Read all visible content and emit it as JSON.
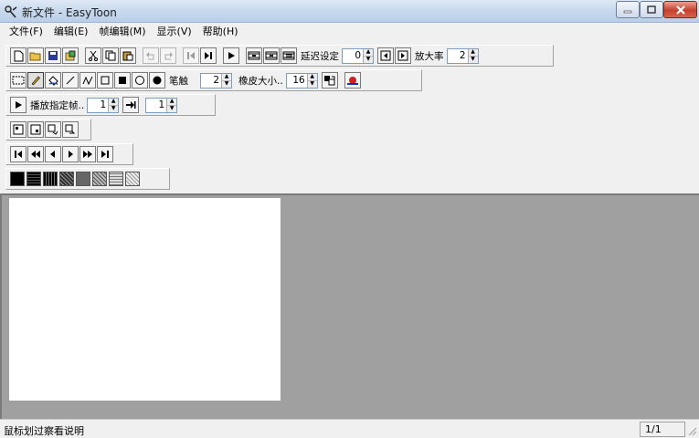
{
  "window": {
    "title": "新文件 - EasyToon",
    "icon": "easytoon-app-icon"
  },
  "menu": [
    "文件(F)",
    "编辑(E)",
    "帧编辑(M)",
    "显示(V)",
    "帮助(H)"
  ],
  "toolbar1": {
    "delay_label": "延迟设定",
    "delay_value": "0",
    "zoom_label": "放大率",
    "zoom_value": "2"
  },
  "toolbar2": {
    "pen_label": "笔触",
    "pen_value": "2",
    "eraser_label": "橡皮大小..",
    "eraser_value": "16"
  },
  "toolbar3": {
    "play_label": "播放指定帧..",
    "from_value": "1",
    "to_value": "1"
  },
  "status": {
    "text": "鼠标划过察看说明",
    "frames": "1/1"
  },
  "colors": {
    "canvas": "#ffffff",
    "workspace": "#a0a0a0",
    "chrome": "#f0f0f0"
  }
}
